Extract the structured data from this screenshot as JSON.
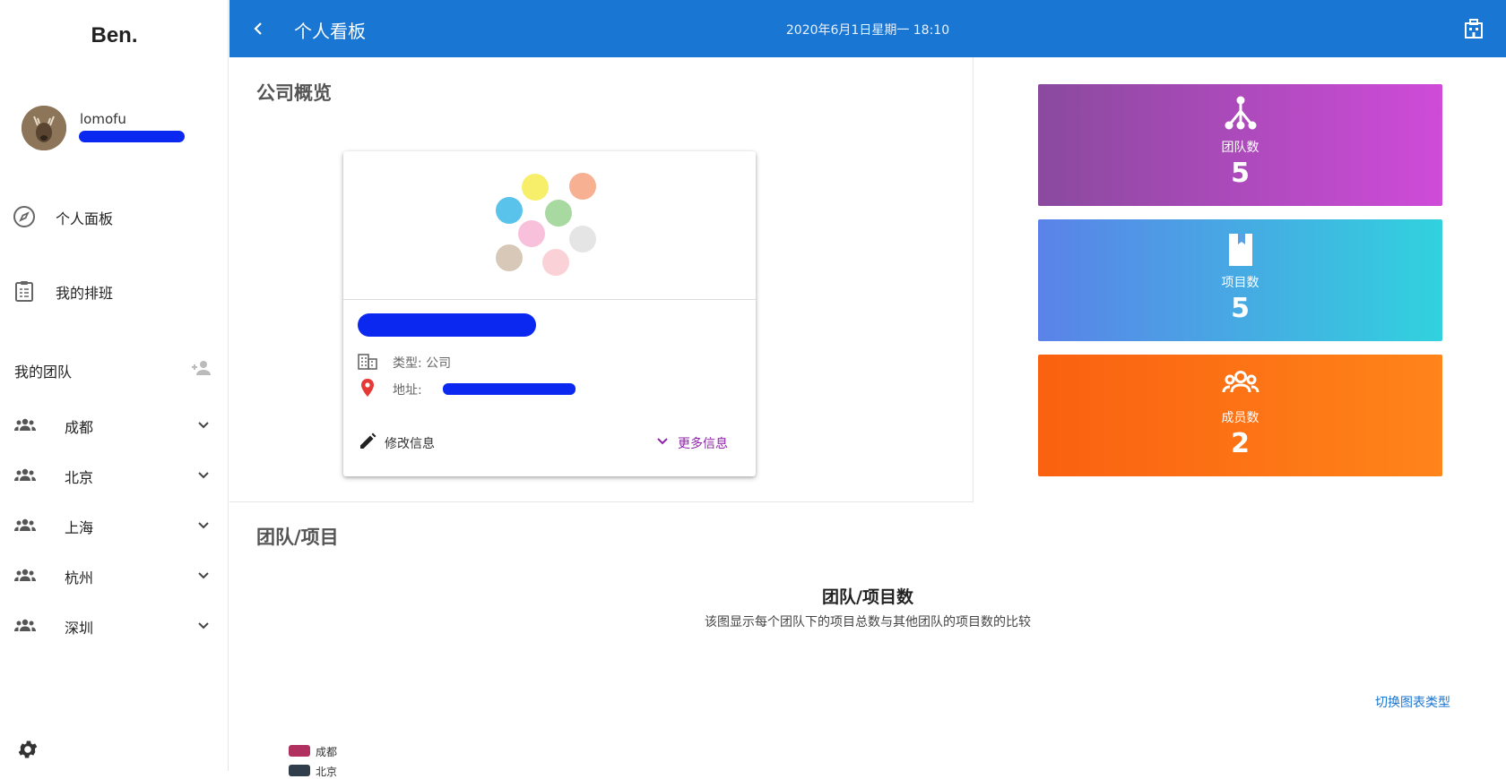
{
  "sidebar": {
    "brand": "Ben.",
    "user": {
      "name": "lomofu"
    },
    "nav": [
      {
        "label": "个人面板",
        "icon": "compass-icon"
      },
      {
        "label": "我的排班",
        "icon": "clipboard-schedule-icon"
      }
    ],
    "teams_title": "我的团队",
    "teams": [
      {
        "label": "成都"
      },
      {
        "label": "北京"
      },
      {
        "label": "上海"
      },
      {
        "label": "杭州"
      },
      {
        "label": "深圳"
      }
    ]
  },
  "topbar": {
    "title": "个人看板",
    "datetime": "2020年6月1日星期一 18:10"
  },
  "overview": {
    "title": "公司概览",
    "company": {
      "type_text": "类型: 公司",
      "address_label": "地址:",
      "edit_label": "修改信息",
      "more_label": "更多信息"
    }
  },
  "stats": {
    "teams": {
      "label": "团队数",
      "value": "5",
      "colors": [
        "#8a4a9e",
        "#cf4bd9"
      ]
    },
    "projects": {
      "label": "项目数",
      "value": "5",
      "colors": [
        "#5b82e8",
        "#31d2de"
      ]
    },
    "members": {
      "label": "成员数",
      "value": "2",
      "colors": [
        "#fa6110",
        "#ff841a"
      ]
    }
  },
  "team_projects": {
    "section_title": "团队/项目",
    "chart_title": "团队/项目数",
    "chart_subtitle": "该图显示每个团队下的项目总数与其他团队的项目数的比较",
    "switch_label": "切换图表类型",
    "legend": [
      {
        "label": "成都",
        "color": "#b03060"
      },
      {
        "label": "北京",
        "color": "#2f3e4a"
      }
    ]
  },
  "colors": {
    "primary": "#1976d2",
    "accent": "#8e24aa",
    "redaction": "#0a28f0"
  }
}
